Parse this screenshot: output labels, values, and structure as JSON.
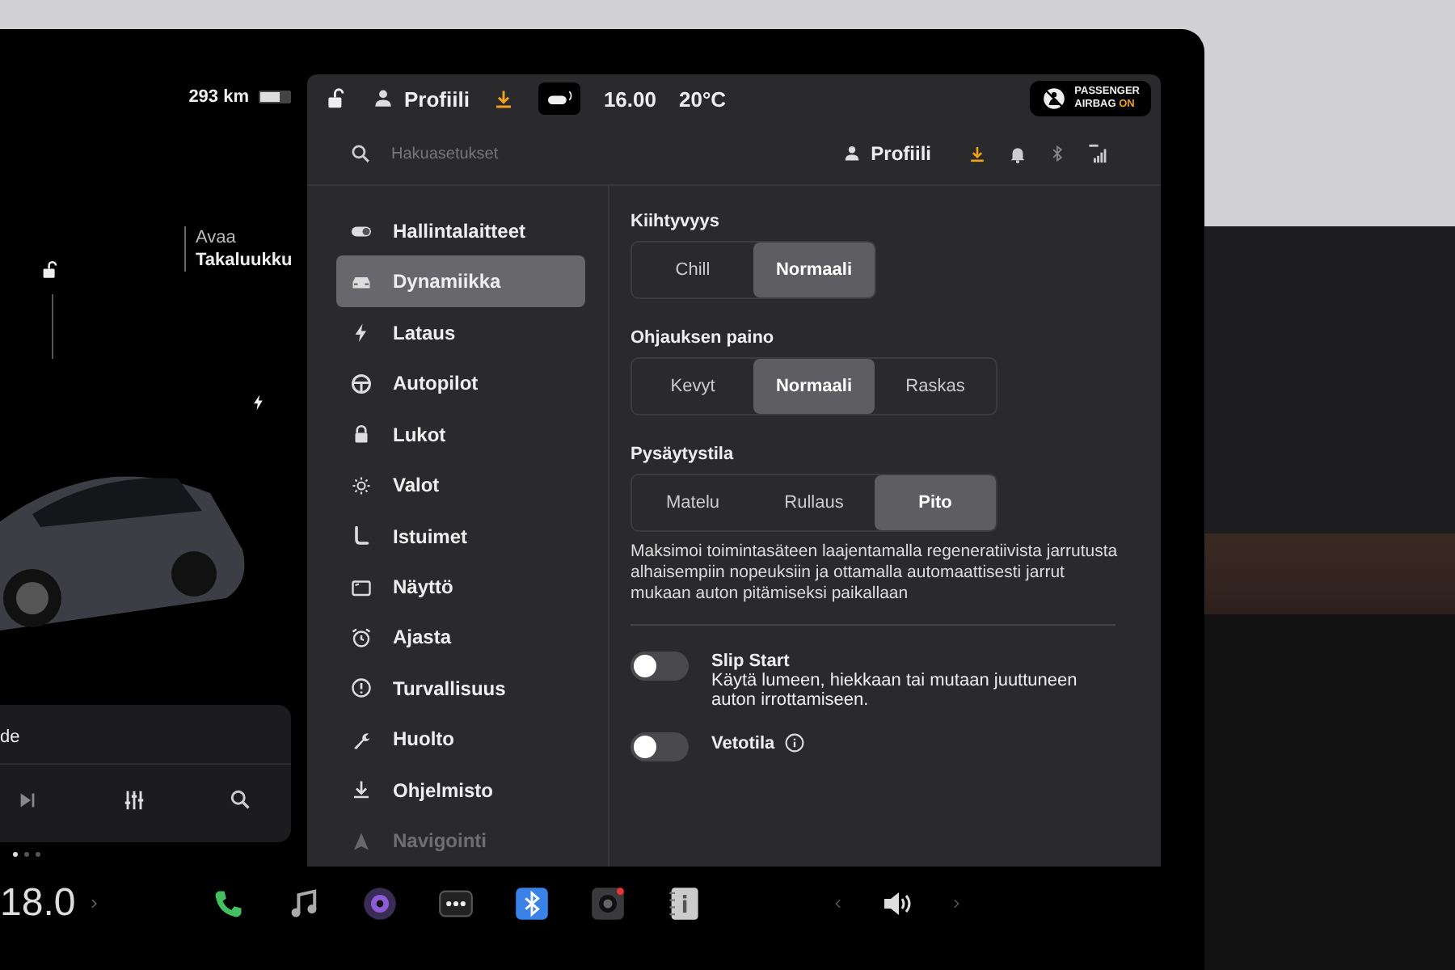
{
  "status_bar": {
    "range": "293 km",
    "profile": "Profiili",
    "time": "16.00",
    "temperature": "20°C",
    "airbag_badge": {
      "line_1": "PASSENGER",
      "line_2": "AIRBAG",
      "state": "ON"
    }
  },
  "car_panel": {
    "trunk_action": "Avaa",
    "trunk_label": "Takaluukku",
    "media_title": "de",
    "page_dots": [
      {
        "selected": true
      },
      {
        "selected": false
      },
      {
        "selected": false
      }
    ]
  },
  "settings": {
    "search": {
      "placeholder": "Hakuasetukset"
    },
    "profile": "Profiili",
    "menu": [
      {
        "kind": "toggle",
        "label": "Hallintalaitteet",
        "selected": false
      },
      {
        "kind": "car",
        "label": "Dynamiikka",
        "selected": true
      },
      {
        "kind": "bolt",
        "label": "Lataus",
        "selected": false
      },
      {
        "kind": "wheel",
        "label": "Autopilot",
        "selected": false
      },
      {
        "kind": "lock",
        "label": "Lukot",
        "selected": false
      },
      {
        "kind": "sun",
        "label": "Valot",
        "selected": false
      },
      {
        "kind": "seat",
        "label": "Istuimet",
        "selected": false
      },
      {
        "kind": "screen",
        "label": "Näyttö",
        "selected": false
      },
      {
        "kind": "alarm",
        "label": "Ajasta",
        "selected": false
      },
      {
        "kind": "alert",
        "label": "Turvallisuus",
        "selected": false
      },
      {
        "kind": "wrench",
        "label": "Huolto",
        "selected": false
      },
      {
        "kind": "download",
        "label": "Ohjelmisto",
        "selected": false
      },
      {
        "kind": "nav",
        "label": "Navigointi",
        "selected": false
      }
    ],
    "sections": [
      {
        "title": "Kiihtyvyys",
        "options": [
          {
            "label": "Chill",
            "selected": false
          },
          {
            "label": "Normaali",
            "selected": true
          }
        ]
      },
      {
        "title": "Ohjauksen paino",
        "options": [
          {
            "label": "Kevyt",
            "selected": false
          },
          {
            "label": "Normaali",
            "selected": true
          },
          {
            "label": "Raskas",
            "selected": false
          }
        ]
      },
      {
        "title": "Pysäytystila",
        "options": [
          {
            "label": "Matelu",
            "selected": false
          },
          {
            "label": "Rullaus",
            "selected": false
          },
          {
            "label": "Pito",
            "selected": true
          }
        ],
        "description": "Maksimoi toimintasäteen laajentamalla regeneratiivista jarrutusta alhaisempiin nopeuksiin ja ottamalla automaattisesti jarrut mukaan auton pitämiseksi paikallaan"
      }
    ],
    "toggles": [
      {
        "title": "Slip Start",
        "description": "Käytä lumeen, hiekkaan tai mutaan juuttuneen auton irrottamiseen.",
        "on": false,
        "info": false
      },
      {
        "title": "Vetotila",
        "on": false,
        "info": true
      }
    ]
  },
  "dock": {
    "temperature": "18.0"
  }
}
